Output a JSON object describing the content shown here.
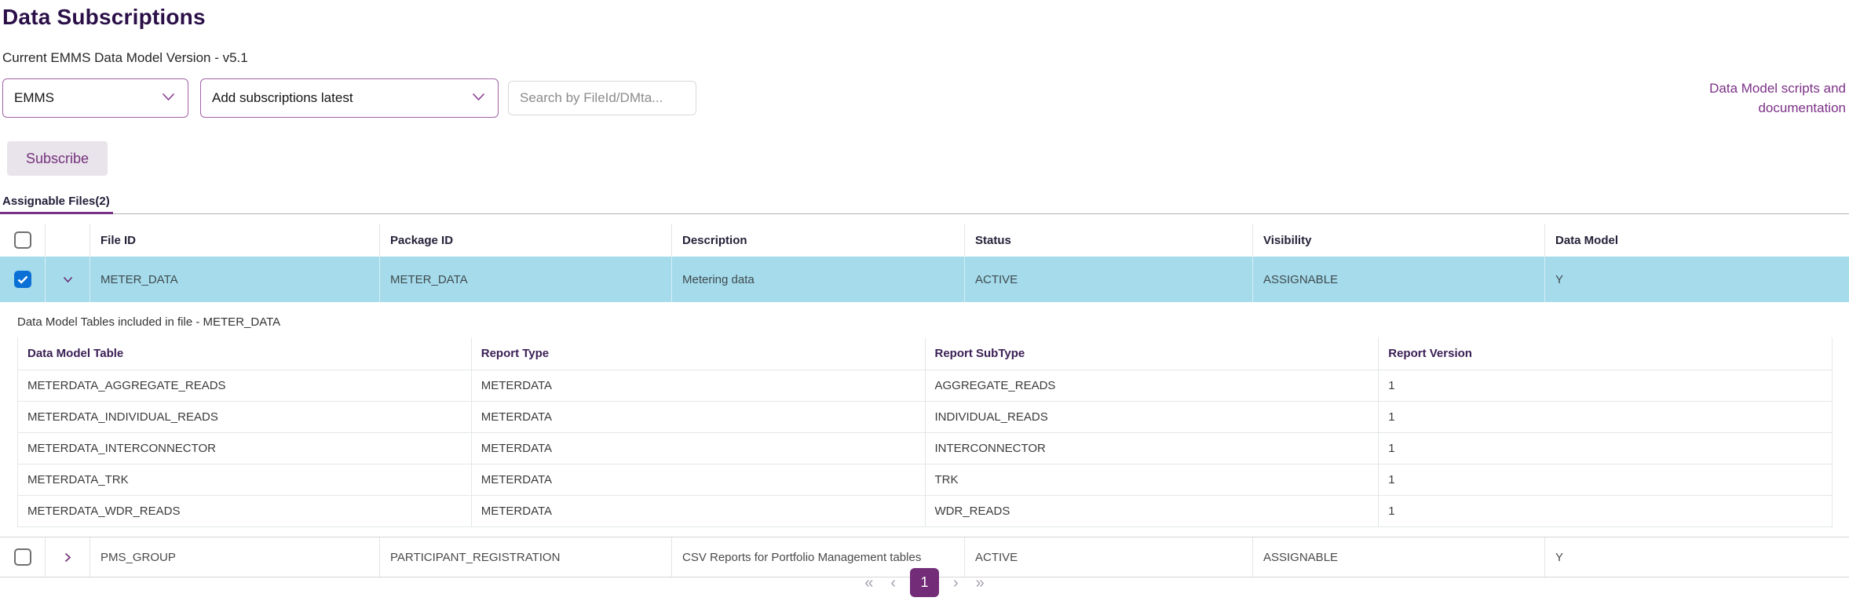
{
  "page": {
    "title": "Data Subscriptions",
    "version_label": "Current EMMS Data Model Version - v5.1"
  },
  "controls": {
    "data_source_dropdown": {
      "value": "EMMS"
    },
    "subscription_dropdown": {
      "value": "Add subscriptions latest"
    },
    "search_input": {
      "placeholder": "Search by FileId/DMta..."
    },
    "docs_link_label": "Data Model scripts and documentation",
    "subscribe_button_label": "Subscribe"
  },
  "files_table": {
    "heading": "Assignable Files(2)",
    "columns": {
      "file_id": "File ID",
      "package_id": "Package ID",
      "description": "Description",
      "status": "Status",
      "visibility": "Visibility",
      "data_model": "Data Model"
    },
    "rows": [
      {
        "file_id": "METER_DATA",
        "package_id": "METER_DATA",
        "description": "Metering data",
        "status": "ACTIVE",
        "visibility": "ASSIGNABLE",
        "data_model": "Y",
        "selected": true,
        "expanded": true
      },
      {
        "file_id": "PMS_GROUP",
        "package_id": "PARTICIPANT_REGISTRATION",
        "description": "CSV Reports for Portfolio Management tables",
        "status": "ACTIVE",
        "visibility": "ASSIGNABLE",
        "data_model": "Y",
        "selected": false,
        "expanded": false
      }
    ],
    "expansion": {
      "label": "Data Model Tables included in file - METER_DATA",
      "columns": {
        "table": "Data Model Table",
        "report_type": "Report Type",
        "report_subtype": "Report SubType",
        "report_version": "Report Version"
      },
      "rows": [
        {
          "table": "METERDATA_AGGREGATE_READS",
          "report_type": "METERDATA",
          "report_subtype": "AGGREGATE_READS",
          "report_version": "1"
        },
        {
          "table": "METERDATA_INDIVIDUAL_READS",
          "report_type": "METERDATA",
          "report_subtype": "INDIVIDUAL_READS",
          "report_version": "1"
        },
        {
          "table": "METERDATA_INTERCONNECTOR",
          "report_type": "METERDATA",
          "report_subtype": "INTERCONNECTOR",
          "report_version": "1"
        },
        {
          "table": "METERDATA_TRK",
          "report_type": "METERDATA",
          "report_subtype": "TRK",
          "report_version": "1"
        },
        {
          "table": "METERDATA_WDR_READS",
          "report_type": "METERDATA",
          "report_subtype": "WDR_READS",
          "report_version": "1"
        }
      ]
    }
  },
  "pagination": {
    "first_label": "«",
    "prev_label": "‹",
    "page_label": "1",
    "next_label": "›",
    "last_label": "»"
  },
  "colors": {
    "accent": "#7c3188",
    "title": "#2b1048",
    "selected_row_bg": "#a5dbeb",
    "checkbox_checked": "#0b70d6",
    "pagination_active_bg": "#732d78",
    "dropdown_border": "#a261a8"
  }
}
